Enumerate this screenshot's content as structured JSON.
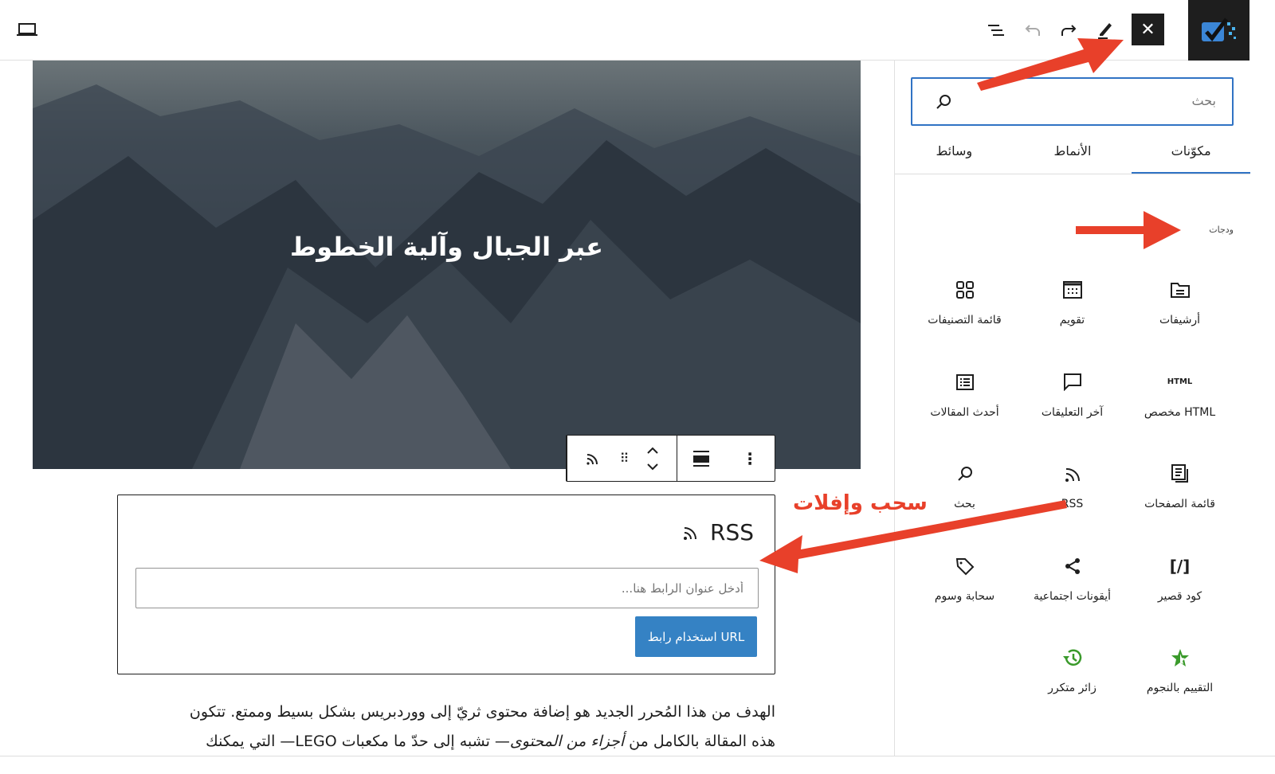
{
  "topbar": {
    "device_preview": "laptop-icon",
    "icons": [
      "list-view-icon",
      "undo-icon",
      "redo-icon",
      "edit-icon",
      "close-icon"
    ]
  },
  "sidebar": {
    "search_placeholder": "بحث",
    "tabs": [
      {
        "label": "مكوّنات",
        "active": true
      },
      {
        "label": "الأنماط"
      },
      {
        "label": "وسائط"
      }
    ],
    "category": "ودجات",
    "blocks": [
      {
        "label": "أرشيفات",
        "icon": "archive-icon"
      },
      {
        "label": "تقويم",
        "icon": "calendar-icon"
      },
      {
        "label": "قائمة التصنيفات",
        "icon": "categories-icon"
      },
      {
        "label": "HTML مخصص",
        "icon": "html-icon",
        "icon_text": "HTML"
      },
      {
        "label": "آخر التعليقات",
        "icon": "comment-icon"
      },
      {
        "label": "أحدث المقالات",
        "icon": "list-icon"
      },
      {
        "label": "قائمة الصفحات",
        "icon": "pages-icon"
      },
      {
        "label": "RSS",
        "icon": "rss-icon"
      },
      {
        "label": "بحث",
        "icon": "search-icon"
      },
      {
        "label": "كود قصير",
        "icon": "shortcode-icon",
        "icon_text": "[/]"
      },
      {
        "label": "أيقونات اجتماعية",
        "icon": "share-icon"
      },
      {
        "label": "سحابة وسوم",
        "icon": "tag-icon"
      },
      {
        "label": "التقييم بالنجوم",
        "icon": "star-icon"
      },
      {
        "label": "زائر متكرر",
        "icon": "history-icon"
      }
    ],
    "accent": "#3073c4",
    "plugin_icon_color": "#3a9a2b"
  },
  "canvas": {
    "hero_title": "عبر الجبال وآلية الخطوط",
    "rss": {
      "title": "RSS",
      "input_placeholder": "أدخل عنوان الرابط هنا...",
      "button": "استخدام رابط URL"
    },
    "paragraph_line1": "الهدف من هذا المُحرر الجديد هو إضافة محتوى ثريّ إلى ووردبريس بشكل بسيط وممتع. تتكون",
    "paragraph_line2_a": "هذه المقالة بالكامل من ",
    "paragraph_line2_em": "أجزاء من المحتوى",
    "paragraph_line2_b": "— تشبه إلى حدّ ما مكعبات LEGO— التي يمكنك"
  },
  "annotation": {
    "drag_drop": "سحب وإفلات",
    "color": "#e8402a"
  }
}
